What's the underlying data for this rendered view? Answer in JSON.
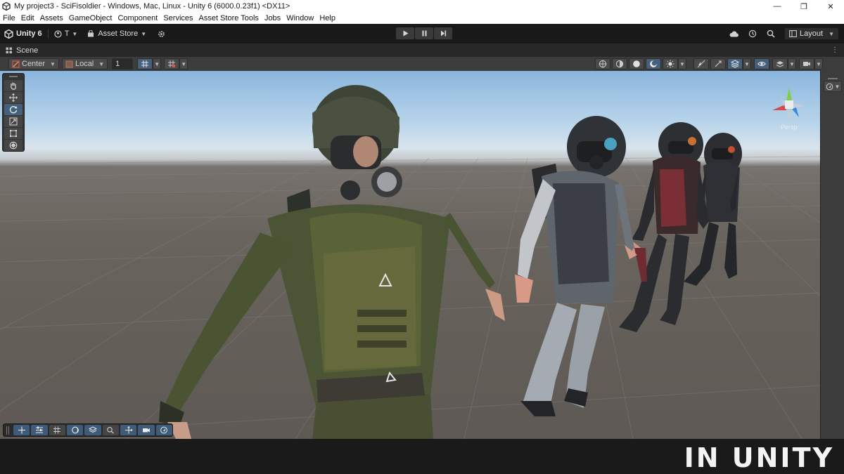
{
  "window": {
    "title": "My project3 - SciFisoldier - Windows, Mac, Linux - Unity 6 (6000.0.23f1) <DX11>",
    "minimize": "—",
    "maximize": "❐",
    "close": "✕"
  },
  "menu": [
    "File",
    "Edit",
    "Assets",
    "GameObject",
    "Component",
    "Services",
    "Asset Store Tools",
    "Jobs",
    "Window",
    "Help"
  ],
  "toolbar": {
    "product": "Unity 6",
    "account_initial": "T",
    "asset_store": "Asset Store",
    "layout": "Layout"
  },
  "scene_tab": {
    "label": "Scene",
    "menu_glyph": "⋮"
  },
  "scene_toolbar": {
    "pivot": "Center",
    "space": "Local",
    "snap_value": "1"
  },
  "viewport": {
    "projection": "Persp"
  },
  "watermark": "IN UNITY",
  "colors": {
    "editor_bg": "#191919",
    "toolbar_bg": "#3c3c3c",
    "active_blue": "#46607c",
    "sky_top": "#8ab6de",
    "ground": "#6a645e"
  }
}
